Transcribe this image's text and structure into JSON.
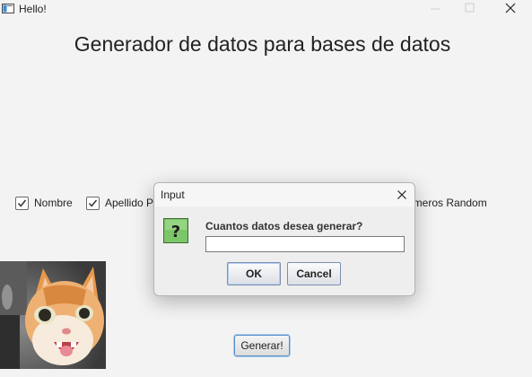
{
  "window": {
    "title": "Hello!",
    "minimize_icon": "minimize-icon",
    "maximize_icon": "maximize-icon",
    "close_icon": "close-icon"
  },
  "main": {
    "heading": "Generador de datos para bases de datos",
    "checkboxes": [
      {
        "label": "Nombre",
        "checked": true
      },
      {
        "label": "Apellido P",
        "checked": true
      }
    ],
    "clipped_label": "umeros Random",
    "generate_label": "Generar!",
    "image": "cat-photo"
  },
  "dialog": {
    "title": "Input",
    "message": "Cuantos datos desea generar?",
    "input_value": "",
    "ok_label": "OK",
    "cancel_label": "Cancel",
    "icon": "question-icon"
  },
  "colors": {
    "background": "#f3f3f3",
    "question_icon_bg": "#7cc66a",
    "generate_border": "#5a8fc8"
  }
}
